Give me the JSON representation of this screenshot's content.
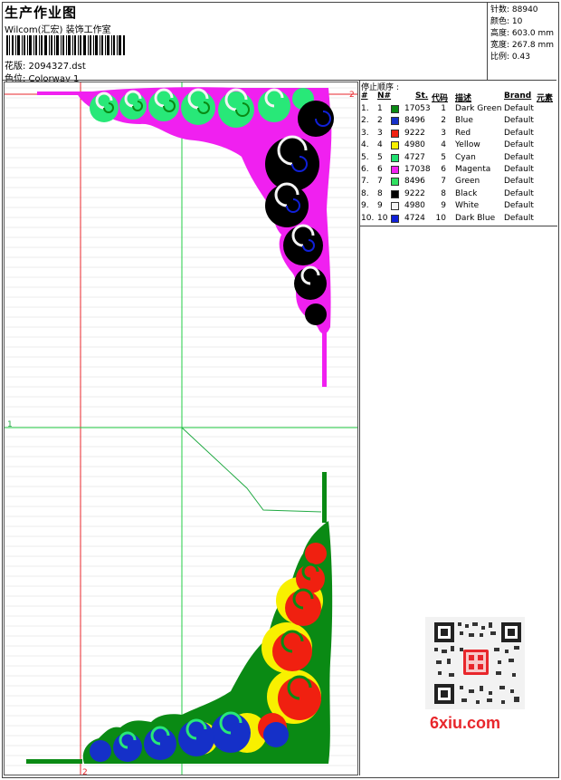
{
  "header": {
    "title": "生产作业图",
    "software": "Wilcom(汇宏) 装饰工作室",
    "design_file": "花版: 2094327.dst",
    "colorway": "色位: Colorway 1"
  },
  "stats": {
    "stitches": "针数: 88940",
    "colors": "颜色: 10",
    "height": "高度: 603.0 mm",
    "width": "宽度: 267.8 mm",
    "scale": "比例: 0.43"
  },
  "panel": {
    "title": "停止顺序 :",
    "headers": {
      "num": "#",
      "n": "N#",
      "st": "St.",
      "code": "代码",
      "desc": "描述",
      "brand": "Brand",
      "elem": "元素"
    },
    "rows": [
      {
        "num": "1.",
        "n": "1",
        "color": "#0a8a14",
        "st": "17053",
        "code": "1",
        "desc": "Dark Green",
        "brand": "Default"
      },
      {
        "num": "2.",
        "n": "2",
        "color": "#1530c8",
        "st": "8496",
        "code": "2",
        "desc": "Blue",
        "brand": "Default"
      },
      {
        "num": "3.",
        "n": "3",
        "color": "#f02010",
        "st": "9222",
        "code": "3",
        "desc": "Red",
        "brand": "Default"
      },
      {
        "num": "4.",
        "n": "4",
        "color": "#f8f000",
        "st": "4980",
        "code": "4",
        "desc": "Yellow",
        "brand": "Default"
      },
      {
        "num": "5.",
        "n": "5",
        "color": "#20e070",
        "st": "4727",
        "code": "5",
        "desc": "Cyan",
        "brand": "Default"
      },
      {
        "num": "6.",
        "n": "6",
        "color": "#f020f0",
        "st": "17038",
        "code": "6",
        "desc": "Magenta",
        "brand": "Default"
      },
      {
        "num": "7.",
        "n": "7",
        "color": "#30e060",
        "st": "8496",
        "code": "7",
        "desc": "Green",
        "brand": "Default"
      },
      {
        "num": "8.",
        "n": "8",
        "color": "#000000",
        "st": "9222",
        "code": "8",
        "desc": "Black",
        "brand": "Default"
      },
      {
        "num": "9.",
        "n": "9",
        "color": "#f4f4f4",
        "st": "4980",
        "code": "9",
        "desc": "White",
        "brand": "Default"
      },
      {
        "num": "10.",
        "n": "10",
        "color": "#1020d8",
        "st": "4724",
        "code": "10",
        "desc": "Dark Blue",
        "brand": "Default"
      }
    ]
  },
  "canvas": {
    "marker_top_right": "2",
    "marker_left": "1",
    "marker_bottom": "2"
  },
  "watermark": {
    "site": "6xiu.com",
    "seal": "刺绣图库"
  },
  "colors": {
    "guide_red": "#e8262b",
    "guide_green": "#22cc44",
    "magenta": "#f020f0",
    "black": "#000000",
    "dark_green": "#0a8a14",
    "yellow": "#f8f000",
    "blue": "#1530c8",
    "red": "#f02010",
    "mint": "#28e878"
  }
}
